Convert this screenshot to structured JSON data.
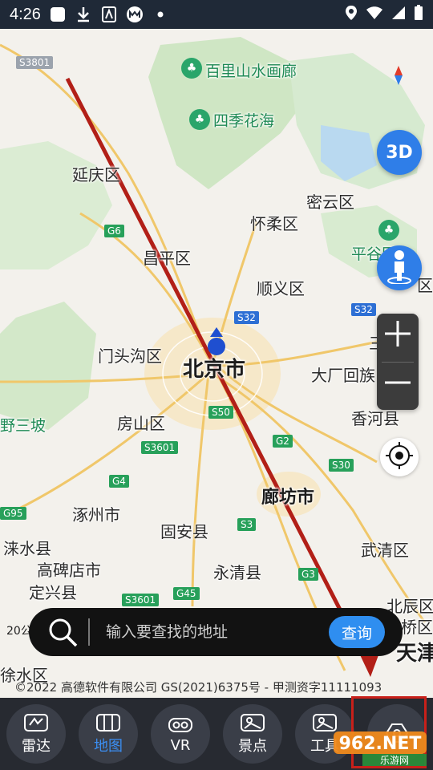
{
  "status": {
    "time": "4:26"
  },
  "map": {
    "labels": {
      "baili": "百里山水画廊",
      "siji": "四季花海",
      "yanqing": "延庆区",
      "miyun": "密云区",
      "huairou": "怀柔区",
      "changping": "昌平区",
      "pinggu": "平谷区",
      "shunyi": "顺义区",
      "mentougou": "门头沟区",
      "beijing": "北京市",
      "dachang": "大厂回族",
      "sanhe": "三",
      "yesanpo": "野三坡",
      "fangshan": "房山区",
      "xianghe": "香河县",
      "zhuozhou": "涿州市",
      "langfang": "廊坊市",
      "guan": "固安县",
      "laishui": "涞水县",
      "gaobeidian": "高碑店市",
      "yongqing": "永清县",
      "wuqing": "武清区",
      "dingxing": "定兴县",
      "beichen": "北辰区",
      "hongqiao": "桥区",
      "tianjin": "天津",
      "xushui": "徐水区",
      "qu": "区"
    },
    "roads": {
      "s3801": "S3801",
      "g6": "G6",
      "s32a": "S32",
      "s32b": "S32",
      "s50": "S50",
      "g2": "G2",
      "s3601a": "S3601",
      "g4": "G4",
      "s30": "S30",
      "g95": "G95",
      "s3601b": "S3601",
      "g45": "G45",
      "s3": "S3",
      "g3": "G3"
    },
    "btn_3d": "3D",
    "scale": "20公",
    "copyright": "©2022 高德软件有限公司 GS(2021)6375号 - 甲测资字11111093"
  },
  "search": {
    "placeholder": "输入要查找的地址",
    "button": "查询"
  },
  "tabs": [
    {
      "label": "雷达"
    },
    {
      "label": "地图"
    },
    {
      "label": "VR"
    },
    {
      "label": "景点"
    },
    {
      "label": "工具"
    }
  ],
  "watermark": {
    "brand": "962.NET",
    "sub": "乐游网"
  },
  "colors": {
    "accent": "#2f8ef0",
    "annotation": "#b21f17",
    "tabbar": "#272a31"
  }
}
